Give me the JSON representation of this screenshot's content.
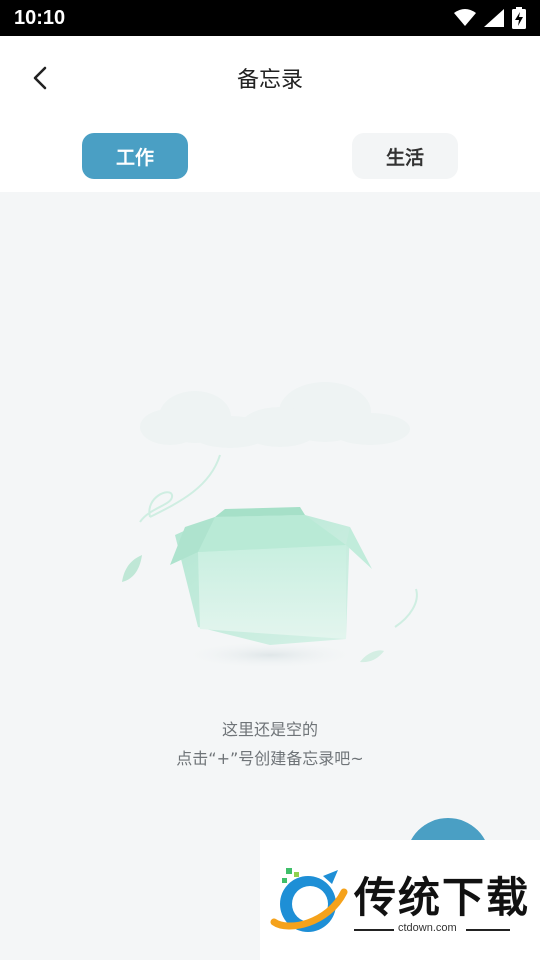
{
  "status_bar": {
    "time": "10:10",
    "icons": [
      "wifi-icon",
      "signal-icon",
      "battery-charging-icon"
    ]
  },
  "header": {
    "back_icon": "chevron-left-icon",
    "title": "备忘录"
  },
  "tabs": [
    {
      "label": "工作",
      "active": true
    },
    {
      "label": "生活",
      "active": false
    }
  ],
  "empty_state": {
    "illustration": "empty-box-illustration",
    "line1": "这里还是空的",
    "line2": "点击“+”号创建备忘录吧~"
  },
  "watermark": {
    "brand": "传统下载",
    "url": "ctdown.com"
  },
  "colors": {
    "accent": "#4a9fc4",
    "background": "#f4f6f7",
    "illustration": "#bfeadb"
  }
}
